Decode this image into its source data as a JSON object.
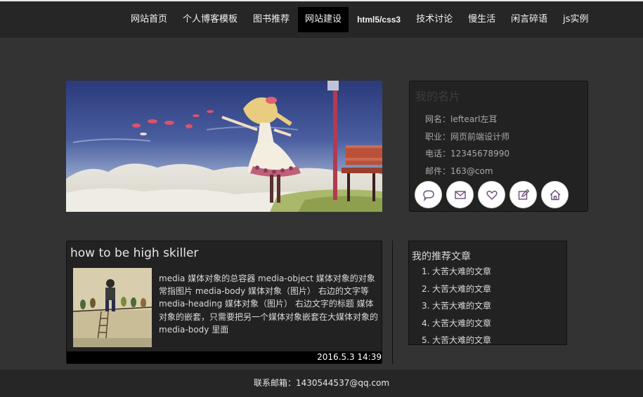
{
  "nav": {
    "items": [
      {
        "label": "网站首页"
      },
      {
        "label": "个人博客模板"
      },
      {
        "label": "图书推荐"
      },
      {
        "label": "网站建设"
      },
      {
        "label": "html5/css3"
      },
      {
        "label": "技术讨论"
      },
      {
        "label": "慢生活"
      },
      {
        "label": "闲言碎语"
      },
      {
        "label": "js实例"
      }
    ],
    "active_label": "网站建设"
  },
  "card": {
    "title": "我的名片",
    "rows": [
      {
        "text": "网名：leftearl左耳"
      },
      {
        "text": "职业：网页前端设计师"
      },
      {
        "text": "电话：12345678990"
      },
      {
        "text": "邮件：163@com"
      }
    ],
    "icons": [
      "speech-bubble-icon",
      "envelope-icon",
      "heart-icon",
      "edit-icon",
      "home-icon"
    ]
  },
  "article": {
    "title": "how to be high skiller",
    "body": "media 媒体对象的总容器 media-object 媒体对象的对象 常指图片 media-body 媒体对象（图片） 右边的文字等 media-heading 媒体对象（图片） 右边文字的标题 媒体对象的嵌套，只需要把另一个媒体对象嵌套在大媒体对象的media-body 里面",
    "date": "2016.5.3 14:39"
  },
  "recommend": {
    "title": "我的推荐文章",
    "items": [
      {
        "num": "1.",
        "label": "大苦大难的文章"
      },
      {
        "num": "2.",
        "label": "大苦大难的文章"
      },
      {
        "num": "3.",
        "label": "大苦大难的文章"
      },
      {
        "num": "4.",
        "label": "大苦大难的文章"
      },
      {
        "num": "5.",
        "label": "大苦大难的文章"
      }
    ]
  },
  "footer": {
    "text": "联系邮箱：1430544537@qq.com"
  },
  "colors": {
    "page_bg": "#333333",
    "bar_bg": "#262626",
    "panel_bg": "#222222",
    "active_nav": "#000000"
  }
}
